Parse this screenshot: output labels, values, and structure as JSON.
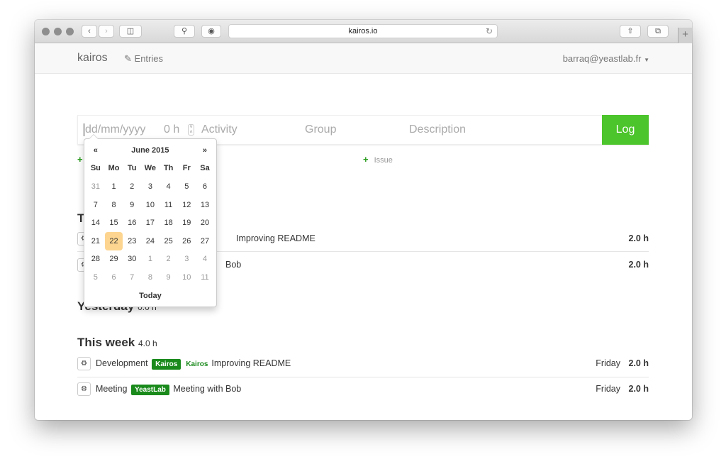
{
  "browser": {
    "url": "kairos.io"
  },
  "navbar": {
    "brand": "kairos",
    "entries": "Entries",
    "user": "barraq@yeastlab.fr"
  },
  "form": {
    "date_placeholder": "dd/mm/yyyy",
    "hours": "0 h",
    "activity_placeholder": "Activity",
    "group_placeholder": "Group",
    "description_placeholder": "Description",
    "log_label": "Log",
    "issue_label": "Issue"
  },
  "colors": {
    "accent": "#4cc42b",
    "badge": "#198a1b",
    "selected_day": "#fdd590"
  },
  "calendar": {
    "prev": "«",
    "next": "»",
    "month": "June 2015",
    "today": "Today",
    "weekdays": [
      "Su",
      "Mo",
      "Tu",
      "We",
      "Th",
      "Fr",
      "Sa"
    ],
    "weeks": [
      [
        {
          "d": "31",
          "m": true
        },
        {
          "d": "1"
        },
        {
          "d": "2"
        },
        {
          "d": "3"
        },
        {
          "d": "4"
        },
        {
          "d": "5"
        },
        {
          "d": "6"
        }
      ],
      [
        {
          "d": "7"
        },
        {
          "d": "8"
        },
        {
          "d": "9"
        },
        {
          "d": "10"
        },
        {
          "d": "11"
        },
        {
          "d": "12"
        },
        {
          "d": "13"
        }
      ],
      [
        {
          "d": "14"
        },
        {
          "d": "15"
        },
        {
          "d": "16"
        },
        {
          "d": "17"
        },
        {
          "d": "18"
        },
        {
          "d": "19"
        },
        {
          "d": "20"
        }
      ],
      [
        {
          "d": "21"
        },
        {
          "d": "22",
          "sel": true
        },
        {
          "d": "23"
        },
        {
          "d": "24"
        },
        {
          "d": "25"
        },
        {
          "d": "26"
        },
        {
          "d": "27"
        }
      ],
      [
        {
          "d": "28"
        },
        {
          "d": "29"
        },
        {
          "d": "30"
        },
        {
          "d": "1",
          "m": true
        },
        {
          "d": "2",
          "m": true
        },
        {
          "d": "3",
          "m": true
        },
        {
          "d": "4",
          "m": true
        }
      ],
      [
        {
          "d": "5",
          "m": true
        },
        {
          "d": "6",
          "m": true
        },
        {
          "d": "7",
          "m": true
        },
        {
          "d": "8",
          "m": true
        },
        {
          "d": "9",
          "m": true
        },
        {
          "d": "10",
          "m": true
        },
        {
          "d": "11",
          "m": true
        }
      ]
    ]
  },
  "today_rows": [
    {
      "text": "Improving README",
      "hours": "2.0 h"
    },
    {
      "text": "Bob",
      "hours": "2.0 h"
    }
  ],
  "yesterday": {
    "title": "Yesterday",
    "total": "0.0 h"
  },
  "this_week": {
    "title": "This week",
    "total": "4.0 h",
    "rows": [
      {
        "activity": "Development",
        "group": "Kairos",
        "project": "Kairos",
        "description": "Improving README",
        "day": "Friday",
        "hours": "2.0 h"
      },
      {
        "activity": "Meeting",
        "group": "YeastLab",
        "description": "Meeting with Bob",
        "day": "Friday",
        "hours": "2.0 h"
      }
    ]
  }
}
